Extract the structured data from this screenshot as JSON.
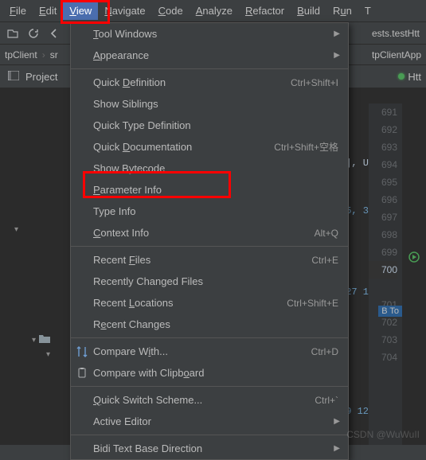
{
  "menubar": {
    "items": [
      {
        "label": "File",
        "mn": 0
      },
      {
        "label": "Edit",
        "mn": 0
      },
      {
        "label": "View",
        "mn": 0,
        "active": true
      },
      {
        "label": "Navigate",
        "mn": 0
      },
      {
        "label": "Code",
        "mn": 0
      },
      {
        "label": "Analyze",
        "mn": 0
      },
      {
        "label": "Refactor",
        "mn": 0
      },
      {
        "label": "Build",
        "mn": 0
      },
      {
        "label": "Run",
        "mn": 1
      },
      {
        "label": "T"
      }
    ]
  },
  "toolbar": {
    "right_text": "ests.testHtt"
  },
  "breadcrumb": {
    "left": "tpClient",
    "mid": "sr",
    "right": "tpClientApp"
  },
  "projectbar": {
    "label": "Project",
    "tab_right": "Htt"
  },
  "dropdown": {
    "items": [
      {
        "type": "item",
        "label": "Tool Windows",
        "mn": 0,
        "submenu": true
      },
      {
        "type": "item",
        "label": "Appearance",
        "mn": 0,
        "submenu": true
      },
      {
        "type": "sep"
      },
      {
        "type": "item",
        "label": "Quick Definition",
        "mn": 6,
        "shortcut": "Ctrl+Shift+I"
      },
      {
        "type": "item",
        "label": "Show Siblings"
      },
      {
        "type": "item",
        "label": "Quick Type Definition"
      },
      {
        "type": "item",
        "label": "Quick Documentation",
        "mn": 6,
        "shortcut": "Ctrl+Shift+空格"
      },
      {
        "type": "item",
        "label": "Show Bytecode",
        "mn": 5
      },
      {
        "type": "item",
        "label": "Parameter Info",
        "mn": 0
      },
      {
        "type": "item",
        "label": "Type Info"
      },
      {
        "type": "item",
        "label": "Context Info",
        "mn": 0,
        "shortcut": "Alt+Q"
      },
      {
        "type": "sep"
      },
      {
        "type": "item",
        "label": "Recent Files",
        "mn": 7,
        "shortcut": "Ctrl+E"
      },
      {
        "type": "item",
        "label": "Recently Changed Files"
      },
      {
        "type": "item",
        "label": "Recent Locations",
        "mn": 7,
        "shortcut": "Ctrl+Shift+E"
      },
      {
        "type": "item",
        "label": "Recent Changes",
        "mn": 1
      },
      {
        "type": "sep"
      },
      {
        "type": "item",
        "label": "Compare With...",
        "mn": 9,
        "shortcut": "Ctrl+D",
        "icon": "compare"
      },
      {
        "type": "item",
        "label": "Compare with Clipboard",
        "mn": 18,
        "icon": "clipboard"
      },
      {
        "type": "sep"
      },
      {
        "type": "item",
        "label": "Quick Switch Scheme...",
        "mn": 0,
        "shortcut": "Ctrl+`"
      },
      {
        "type": "item",
        "label": "Active Editor",
        "submenu": true
      },
      {
        "type": "sep"
      },
      {
        "type": "item",
        "label": "Bidi Text Base Direction",
        "submenu": true
      }
    ]
  },
  "gutter_lines": [
    "691",
    "692",
    "693",
    "694",
    "695",
    "696",
    "697",
    "698",
    "699",
    "700",
    "",
    "701",
    "702",
    "703",
    "704"
  ],
  "gutter_highlight": "700",
  "code_fragments": {
    "f1": "[], U",
    "f2": "5, 3",
    "f3": "27 1",
    "f4": "9 12",
    "btoken": "B To"
  },
  "watermark": "CSDN @WuWuII"
}
